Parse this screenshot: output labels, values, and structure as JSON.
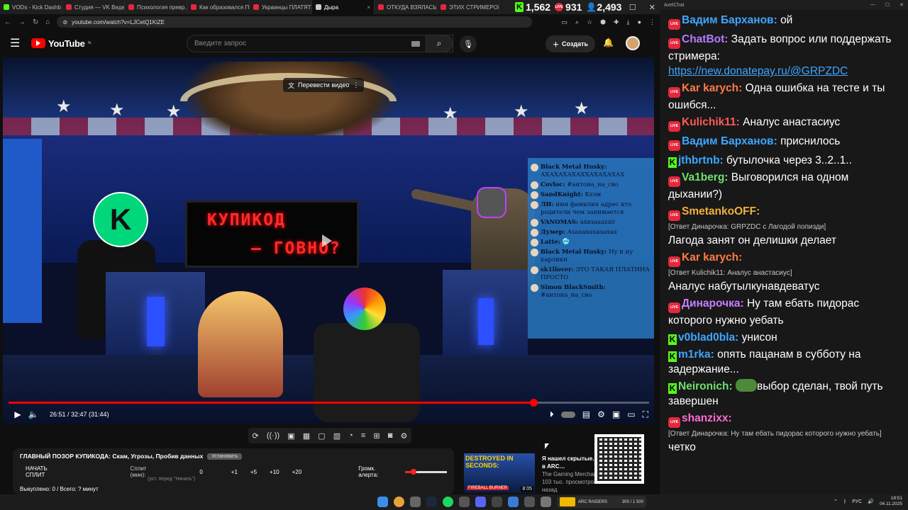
{
  "browser": {
    "tabs": [
      {
        "label": "VODs - Kick Dashb",
        "color": "#53fc18"
      },
      {
        "label": "Студия — VK Видео",
        "color": "#e5283c"
      },
      {
        "label": "Психология превр…",
        "color": "#e5283c"
      },
      {
        "label": "Как образовался П…",
        "color": "#e5283c"
      },
      {
        "label": "Украинцы ПЛАТЯТ",
        "color": "#e5283c"
      },
      {
        "label": "Дыра",
        "color": "#cccccc"
      },
      {
        "label": "ОТКУДА ВЗЯЛАСЬ…",
        "color": "#e5283c"
      },
      {
        "label": "ЭТИХ СТРИМЕРОВ",
        "color": "#e5283c"
      }
    ],
    "url": "youtube.com/watch?v=LJCetQ1KiZE",
    "counters": {
      "kick": "1,562",
      "youtube": "931",
      "viewers": "2,493"
    },
    "window_controls": [
      "—",
      "☐",
      "✕"
    ]
  },
  "youtube": {
    "logo": "YouTube",
    "region": "NL",
    "search_placeholder": "Введите запрос",
    "create_label": "Создать",
    "translate_label": "Перевести видео",
    "time": "26:51 / 32:47 (31:44)",
    "progress_fraction": 0.82,
    "video_screen_line1": "КУПИКОД",
    "video_screen_line2": "– ГОВНО?",
    "overlay_chat": [
      {
        "user": "Black Metal Husky:",
        "text": "АХАХАХАХАХХАХАХАХАХ"
      },
      {
        "user": "Covloc:",
        "text": "#антона_на_сво"
      },
      {
        "user": "SandKnight:",
        "text": "Кхэм"
      },
      {
        "user": "ЛИ:",
        "text": "имя фамилия адрес кто родители чем занимается"
      },
      {
        "user": "VANOMAS:",
        "text": "ахвзахахх0"
      },
      {
        "user": "Думер:",
        "text": "Ахахахахахахах"
      },
      {
        "user": "Latte:",
        "text": "🥶"
      },
      {
        "user": "Black Metal Husky:",
        "text": "Ну и ну карлики"
      },
      {
        "user": "sk1llover:",
        "text": "ЭТО ТАКАЯ ПЛАТИНА ПРОСТО"
      },
      {
        "user": "Simon BlackSmith:",
        "text": "#антона_на_сво"
      }
    ]
  },
  "panel": {
    "title": "ГЛАВНЫЙ ПОЗОР КУПИКОДА: Скам, Угрозы, Пробив данных",
    "badge": "Установить",
    "start_split": "НАЧАТЬ СПЛИТ",
    "split_label": "Сплит (мин):",
    "split_sub": "(уст. перед \"Начать\")",
    "split_value": "0",
    "increments": [
      "+1",
      "+5",
      "+10",
      "+20"
    ],
    "alert_label": "Громк. алерта:",
    "alert_volume": 0.2,
    "bought": "Выкуплено: 0 / Всего: ? минут"
  },
  "recommendation": {
    "thumb_title": "DESTROYED IN SECONDS:",
    "thumb_tag": "FIREBALL BURNER",
    "duration": "8:05",
    "title": "Я нашел скрытые… каждого ARC в ARC…",
    "channel": "The Gaming Merchant",
    "meta": "103 тыс. просмотров • 13 часов назад"
  },
  "chat": {
    "window_title": "AxelChat",
    "messages": [
      {
        "platform": "yt",
        "user": "Вадим Барханов:",
        "color": "#3ea6ff",
        "text": "ой"
      },
      {
        "platform": "yt",
        "user": "ChatBot:",
        "color": "#b57cff",
        "text": "Задать вопрос или поддержать стримера:",
        "link": "https://new.donatepay.ru/@GRPZDC"
      },
      {
        "platform": "yt",
        "user": "Kar karych:",
        "color": "#ff7a45",
        "text": "Одна ошибка на тесте и ты ошибся..."
      },
      {
        "platform": "yt",
        "user": "Kulichik11:",
        "color": "#ff5a5a",
        "text": "Аналус анастасиус"
      },
      {
        "platform": "yt",
        "user": "Вадим Барханов:",
        "color": "#3ea6ff",
        "text": "приснилось"
      },
      {
        "platform": "kick",
        "user": "jthbrtnb:",
        "color": "#3ea6ff",
        "text": "бутылочка через 3..2..1.."
      },
      {
        "platform": "yt",
        "user": "Va1berg:",
        "color": "#6ee06e",
        "text": "Выговорился на одном дыхании?)"
      },
      {
        "platform": "yt",
        "user": "SmetankoOFF:",
        "color": "#f0b13a",
        "reply": "[Ответ Динарочка: GRPZDC с Лагодой попизди]",
        "text": "Лагода занят он делишки делает"
      },
      {
        "platform": "yt",
        "user": "Kar karych:",
        "color": "#ff7a45",
        "reply": "[Ответ Kulichik11: Аналус анастасиус]",
        "text": "Аналус набутылкунавдеватус"
      },
      {
        "platform": "yt",
        "user": "Динарочка:",
        "color": "#c87dff",
        "text": "Ну там ебать пидорас которого нужно уебать"
      },
      {
        "platform": "kick",
        "user": "v0blad0bla:",
        "color": "#3ea6ff",
        "text": "унисон"
      },
      {
        "platform": "kick",
        "user": "m1rka:",
        "color": "#3ea6ff",
        "text": "опять пацанам в субботу на задержание..."
      },
      {
        "platform": "kick",
        "user": "Neironich:",
        "color": "#6ee06e",
        "emote": true,
        "text": "выбор сделан, твой путь завершен"
      },
      {
        "platform": "yt",
        "user": "shanzixx:",
        "color": "#ff6bd5",
        "reply": "[Ответ Динарочка: Ну там ебать пидорас которого нужно уебать]",
        "text": "четко"
      }
    ]
  },
  "taskbar": {
    "game_title": "ARC RAIDERS",
    "game_stat": "300 / 1 500",
    "lang": "РУС",
    "time": "18:51",
    "date": "04.11.2025"
  }
}
